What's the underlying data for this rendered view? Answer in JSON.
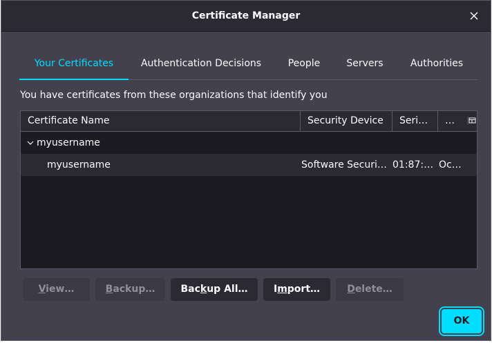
{
  "window": {
    "title": "Certificate Manager"
  },
  "tabs": [
    {
      "label": "Your Certificates",
      "selected": true
    },
    {
      "label": "Authentication Decisions"
    },
    {
      "label": "People"
    },
    {
      "label": "Servers"
    },
    {
      "label": "Authorities"
    }
  ],
  "description": "You have certificates from these organizations that identify you",
  "tree": {
    "columns": [
      "Certificate Name",
      "Security Device",
      "Seri…",
      "…"
    ],
    "group": {
      "label": "myusername",
      "expanded": true
    },
    "rows": [
      {
        "name": "myusername",
        "device": "Software Securi…",
        "serial": "01:87:…",
        "expires": "Oc…"
      }
    ]
  },
  "buttons": {
    "view": {
      "label": "View…",
      "mnemonic": "V",
      "rest": "iew…",
      "enabled": false
    },
    "backup": {
      "label": "Backup…",
      "mnemonic": "B",
      "rest": "ackup…",
      "enabled": false
    },
    "backup_all": {
      "label": "Backup All…",
      "pre": "Bac",
      "mnemonic": "k",
      "rest": "up All…",
      "enabled": true
    },
    "import": {
      "label": "Import…",
      "pre": "I",
      "mnemonic": "m",
      "rest": "port…",
      "enabled": true
    },
    "delete": {
      "label": "Delete…",
      "mnemonic": "D",
      "rest": "elete…",
      "enabled": false
    },
    "ok": {
      "label": "OK"
    }
  },
  "colors": {
    "accent": "#00ddff",
    "window_bg": "#42414d",
    "titlebar_bg": "#2b2a33",
    "tree_bg": "#1c1b22"
  }
}
